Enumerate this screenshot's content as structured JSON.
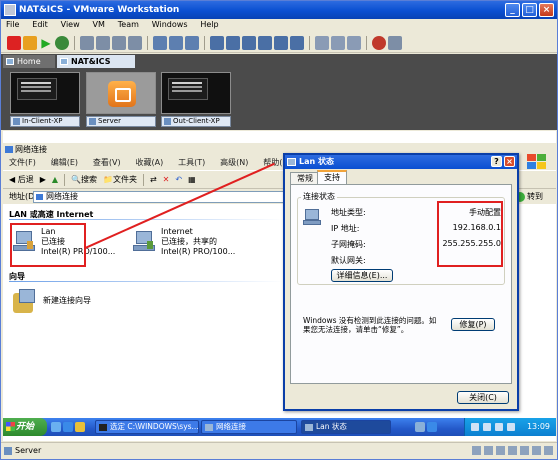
{
  "vmware": {
    "title": "NAT&ICS - VMware Workstation",
    "menu": [
      "File",
      "Edit",
      "View",
      "VM",
      "Team",
      "Windows",
      "Help"
    ],
    "tabs": [
      {
        "label": "Home"
      },
      {
        "label": "NAT&ICS"
      }
    ],
    "thumbnails": [
      {
        "label": "In-Client-XP"
      },
      {
        "label": "Server"
      },
      {
        "label": "Out-Client-XP"
      }
    ],
    "status_text": "Server"
  },
  "netconn": {
    "title": "网络连接",
    "menu": [
      "文件(F)",
      "编辑(E)",
      "查看(V)",
      "收藏(A)",
      "工具(T)",
      "高级(N)",
      "帮助(H)"
    ],
    "toolbar": {
      "back": "后退",
      "search": "搜索",
      "folders": "文件夹"
    },
    "address_label": "地址(D)",
    "address_value": "网络连接",
    "go_label": "转到",
    "group_lan": "LAN 或高速 Internet",
    "group_wizard": "向导",
    "connections": [
      {
        "name": "Lan",
        "status": "已连接",
        "device": "Intel(R) PRO/100..."
      },
      {
        "name": "Internet",
        "status": "已连接，共享的",
        "device": "Intel(R) PRO/100..."
      }
    ],
    "wizard_label": "新建连接向导"
  },
  "dialog": {
    "title": "Lan 状态",
    "tabs": [
      "常规",
      "支持"
    ],
    "group_label": "连接状态",
    "rows": [
      {
        "label": "地址类型:",
        "value": "手动配置"
      },
      {
        "label": "IP 地址:",
        "value": "192.168.0.1"
      },
      {
        "label": "子网掩码:",
        "value": "255.255.255.0"
      },
      {
        "label": "默认网关:",
        "value": ""
      }
    ],
    "details_button": "详细信息(E)...",
    "message": "Windows 没有检测到此连接的问题。如果您无法连接，请单击“修复”。",
    "repair_button": "修复(P)",
    "close_button": "关闭(C)"
  },
  "taskbar": {
    "start_label": "开始",
    "tasks": [
      {
        "label": "选定 C:\\WINDOWS\\sys..."
      },
      {
        "label": "网络连接"
      },
      {
        "label": "Lan 状态"
      }
    ],
    "clock": "13:09"
  }
}
